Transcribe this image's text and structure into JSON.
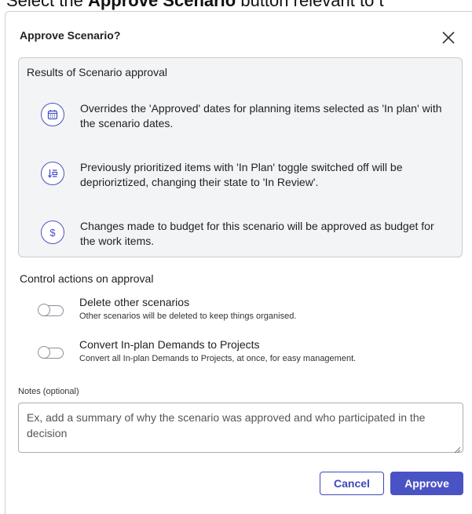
{
  "top_caption": {
    "prefix": "Select the ",
    "bold": "Approve Scenario",
    "suffix": " button relevant to t"
  },
  "dialog": {
    "title": "Approve Scenario?",
    "close_icon": "close-icon"
  },
  "results": {
    "title": "Results of Scenario approval",
    "items": [
      {
        "icon": "calendar-icon",
        "text": "Overrides the 'Approved' dates for planning items selected as 'In plan' with the scenario dates."
      },
      {
        "icon": "sort-priority-icon",
        "text": "Previously prioritized items with 'In Plan' toggle switched off will be deprioriztized, changing their state to 'In Review'."
      },
      {
        "icon": "dollar-icon",
        "text": "Changes made to budget for this scenario will be approved as budget for the work items."
      }
    ]
  },
  "controls": {
    "title": "Control actions on approval",
    "items": [
      {
        "label": "Delete other scenarios",
        "desc": "Other scenarios will be deleted to keep things organised.",
        "enabled": false
      },
      {
        "label": "Convert In-plan Demands to Projects",
        "desc": "Convert all In-plan Demands to Projects, at once, for easy management.",
        "enabled": false
      }
    ]
  },
  "notes": {
    "label": "Notes (optional)",
    "placeholder": "Ex, add a summary of why the scenario was approved and who participated in the decision",
    "value": ""
  },
  "buttons": {
    "cancel": "Cancel",
    "approve": "Approve"
  },
  "colors": {
    "accent": "#4a53c4",
    "panel_bg": "#f3f4f6",
    "toggle_off": "#8a8f98"
  }
}
